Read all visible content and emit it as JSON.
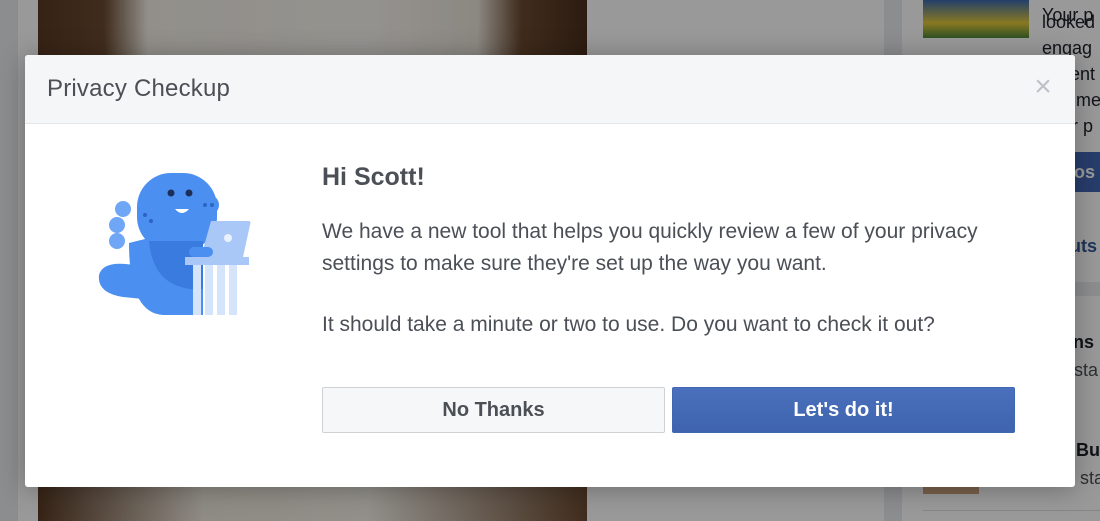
{
  "dialog": {
    "title": "Privacy Checkup",
    "close_icon": "close-icon",
    "greeting": "Hi Scott!",
    "message_1": "We have a new tool that helps you quickly review a few of your privacy settings to make sure they're set up the way you want.",
    "message_2": "It should take a minute or two to use. Do you want to check it out?",
    "illustration": "dinosaur-with-laptop-icon",
    "buttons": {
      "no_thanks": "No Thanks",
      "lets_do_it": "Let's do it!"
    }
  },
  "background": {
    "right_column": {
      "lines": [
        "Your p",
        "looked",
        "engag",
        "ent",
        "nme",
        "r p"
      ],
      "button_label": "os",
      "link": "uts",
      "item_1": "ins",
      "item_1_sub": "sta",
      "item_2": "Bu",
      "item_2_sub": "sta"
    }
  },
  "colors": {
    "primary_button": "#4267b2",
    "text": "#4b4f56",
    "header_bg": "#f5f6f7",
    "dino_blue": "#4b8ff0"
  }
}
